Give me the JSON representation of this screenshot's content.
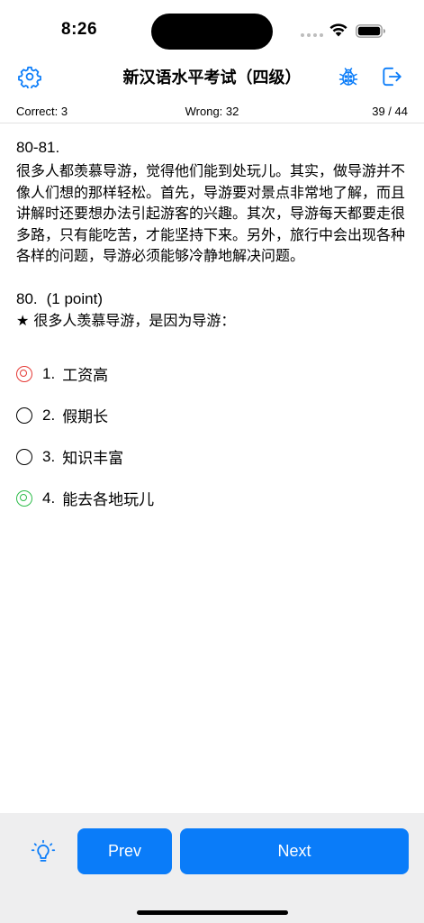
{
  "status_bar": {
    "time": "8:26"
  },
  "nav": {
    "title": "新汉语水平考试（四级）",
    "icons": [
      "gear-icon",
      "ladybug-icon",
      "exit-icon"
    ],
    "accent_color": "#0a7cf9"
  },
  "score": {
    "correct": "Correct: 3",
    "wrong": "Wrong: 32",
    "progress": "39 / 44"
  },
  "passage": {
    "number": "80-81.",
    "text": "很多人都羡慕导游，觉得他们能到处玩儿。其实，做导游并不像人们想的那样轻松。首先，导游要对景点非常地了解，而且讲解时还要想办法引起游客的兴趣。其次，导游每天都要走很多路，只有能吃苦，才能坚持下来。另外，旅行中会出现各种各样的问题，导游必须能够冷静地解决问题。"
  },
  "question": {
    "number": "80.",
    "points": "(1 point)",
    "text": "★ 很多人羡慕导游，是因为导游："
  },
  "options": [
    {
      "num": "1.",
      "label": "工资高",
      "state": "wrong",
      "color": "#e53935"
    },
    {
      "num": "2.",
      "label": "假期长",
      "state": "none"
    },
    {
      "num": "3.",
      "label": "知识丰富",
      "state": "none"
    },
    {
      "num": "4.",
      "label": "能去各地玩儿",
      "state": "correct",
      "color": "#2ebd4b"
    }
  ],
  "toolbar": {
    "prev_label": "Prev",
    "next_label": "Next",
    "bulb_icon": "lightbulb-icon",
    "button_color": "#0a7cf9"
  }
}
